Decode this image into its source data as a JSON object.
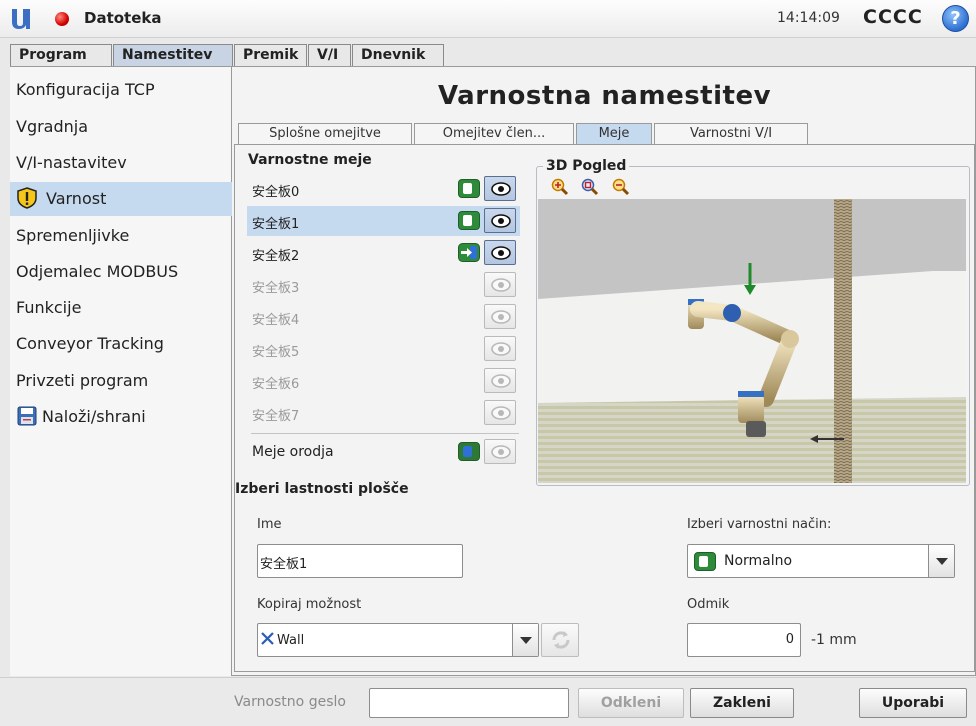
{
  "header": {
    "menu": "Datoteka",
    "time": "14:14:09",
    "robot_name": "CCCC",
    "help_label": "?"
  },
  "main_tabs": [
    "Program",
    "Namestitev",
    "Premik",
    "V/I",
    "Dnevnik"
  ],
  "sidebar": {
    "items": [
      {
        "label": "Konfiguracija TCP"
      },
      {
        "label": "Vgradnja"
      },
      {
        "label": "V/I-nastavitev"
      },
      {
        "label": "Varnost",
        "icon": "warning-shield-icon",
        "active": true
      },
      {
        "label": "Spremenljivke"
      },
      {
        "label": "Odjemalec MODBUS"
      },
      {
        "label": "Funkcije"
      },
      {
        "label": "Conveyor Tracking"
      },
      {
        "label": "Privzeti program"
      },
      {
        "label": "Naloži/shrani",
        "icon": "save-disk-icon"
      }
    ]
  },
  "page_title": "Varnostna namestitev",
  "sub_tabs": [
    "Splošne omejitve",
    "Omejitev člen...",
    "Meje",
    "Varnostni V/I"
  ],
  "boundaries": {
    "heading": "Varnostne meje",
    "planes": [
      {
        "name": "安全板0",
        "state": "normal",
        "visible": true
      },
      {
        "name": "安全板1",
        "state": "normal",
        "visible": true,
        "selected": true
      },
      {
        "name": "安全板2",
        "state": "trigger",
        "visible": true
      },
      {
        "name": "安全板3",
        "state": "disabled",
        "visible": false
      },
      {
        "name": "安全板4",
        "state": "disabled",
        "visible": false
      },
      {
        "name": "安全板5",
        "state": "disabled",
        "visible": false
      },
      {
        "name": "安全板6",
        "state": "disabled",
        "visible": false
      },
      {
        "name": "安全板7",
        "state": "disabled",
        "visible": false
      }
    ],
    "tool_limits_label": "Meje orodja"
  },
  "view3d": {
    "title": "3D Pogled",
    "zoom_icons": [
      "zoom-in-icon",
      "zoom-fit-icon",
      "zoom-out-icon"
    ]
  },
  "properties": {
    "heading": "Izberi lastnosti plošče",
    "name_label": "Ime",
    "name_value": "安全板1",
    "copy_label": "Kopiraj možnost",
    "copy_value": "Wall",
    "mode_label": "Izberi varnostni način:",
    "mode_value": "Normalno",
    "offset_label": "Odmik",
    "offset_value": "0",
    "offset_unit": "-1 mm"
  },
  "footer": {
    "password_label": "Varnostno geslo",
    "unlock_label": "Odkleni",
    "lock_label": "Zakleni",
    "apply_label": "Uporabi"
  },
  "colors": {
    "accent": "#c5d9ef",
    "toggle_green": "#2e8b3a",
    "help_blue": "#2d6fd0",
    "status_red": "#d50000"
  }
}
